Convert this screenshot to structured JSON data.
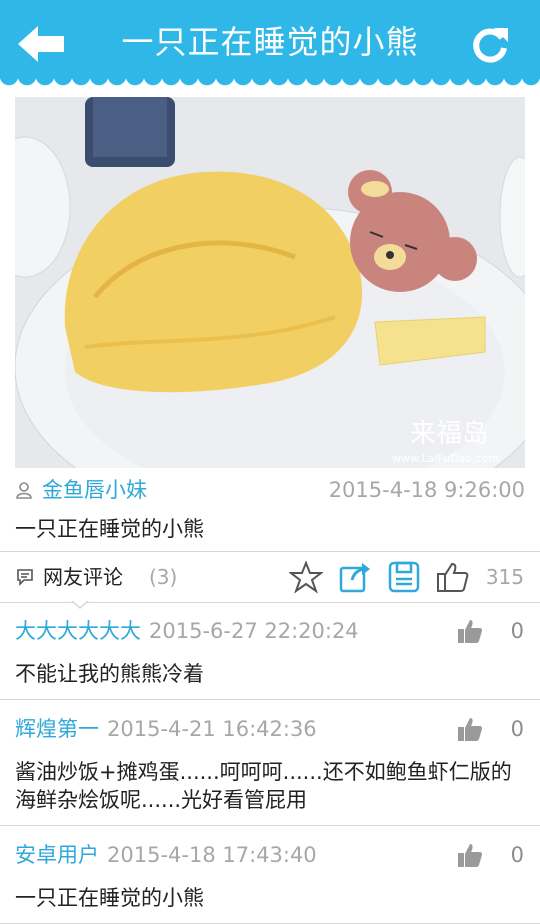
{
  "header": {
    "title": "一只正在睡觉的小熊"
  },
  "post": {
    "author": "金鱼唇小妹",
    "time": "2015-4-18 9:26:00",
    "text": "一只正在睡觉的小熊",
    "watermark": {
      "brand": "来福岛",
      "url": "www.LaiFuDao.com"
    }
  },
  "actions": {
    "comments_label": "网友评论",
    "comments_count": "(3)",
    "likes": "315"
  },
  "comments": [
    {
      "user": "大大大大大大",
      "time": "2015-6-27 22:20:24",
      "likes": "0",
      "text": "不能让我的熊熊冷着"
    },
    {
      "user": "辉煌第一",
      "time": "2015-4-21 16:42:36",
      "likes": "0",
      "text": "酱油炒饭+摊鸡蛋......呵呵呵......还不如鲍鱼虾仁版的海鲜杂烩饭呢......光好看管屁用"
    },
    {
      "user": "安卓用户",
      "time": "2015-4-18 17:43:40",
      "likes": "0",
      "text": "一只正在睡觉的小熊"
    }
  ],
  "colors": {
    "accent": "#2fb7e8",
    "link": "#2fa9d9",
    "muted": "#a7a7a7"
  }
}
